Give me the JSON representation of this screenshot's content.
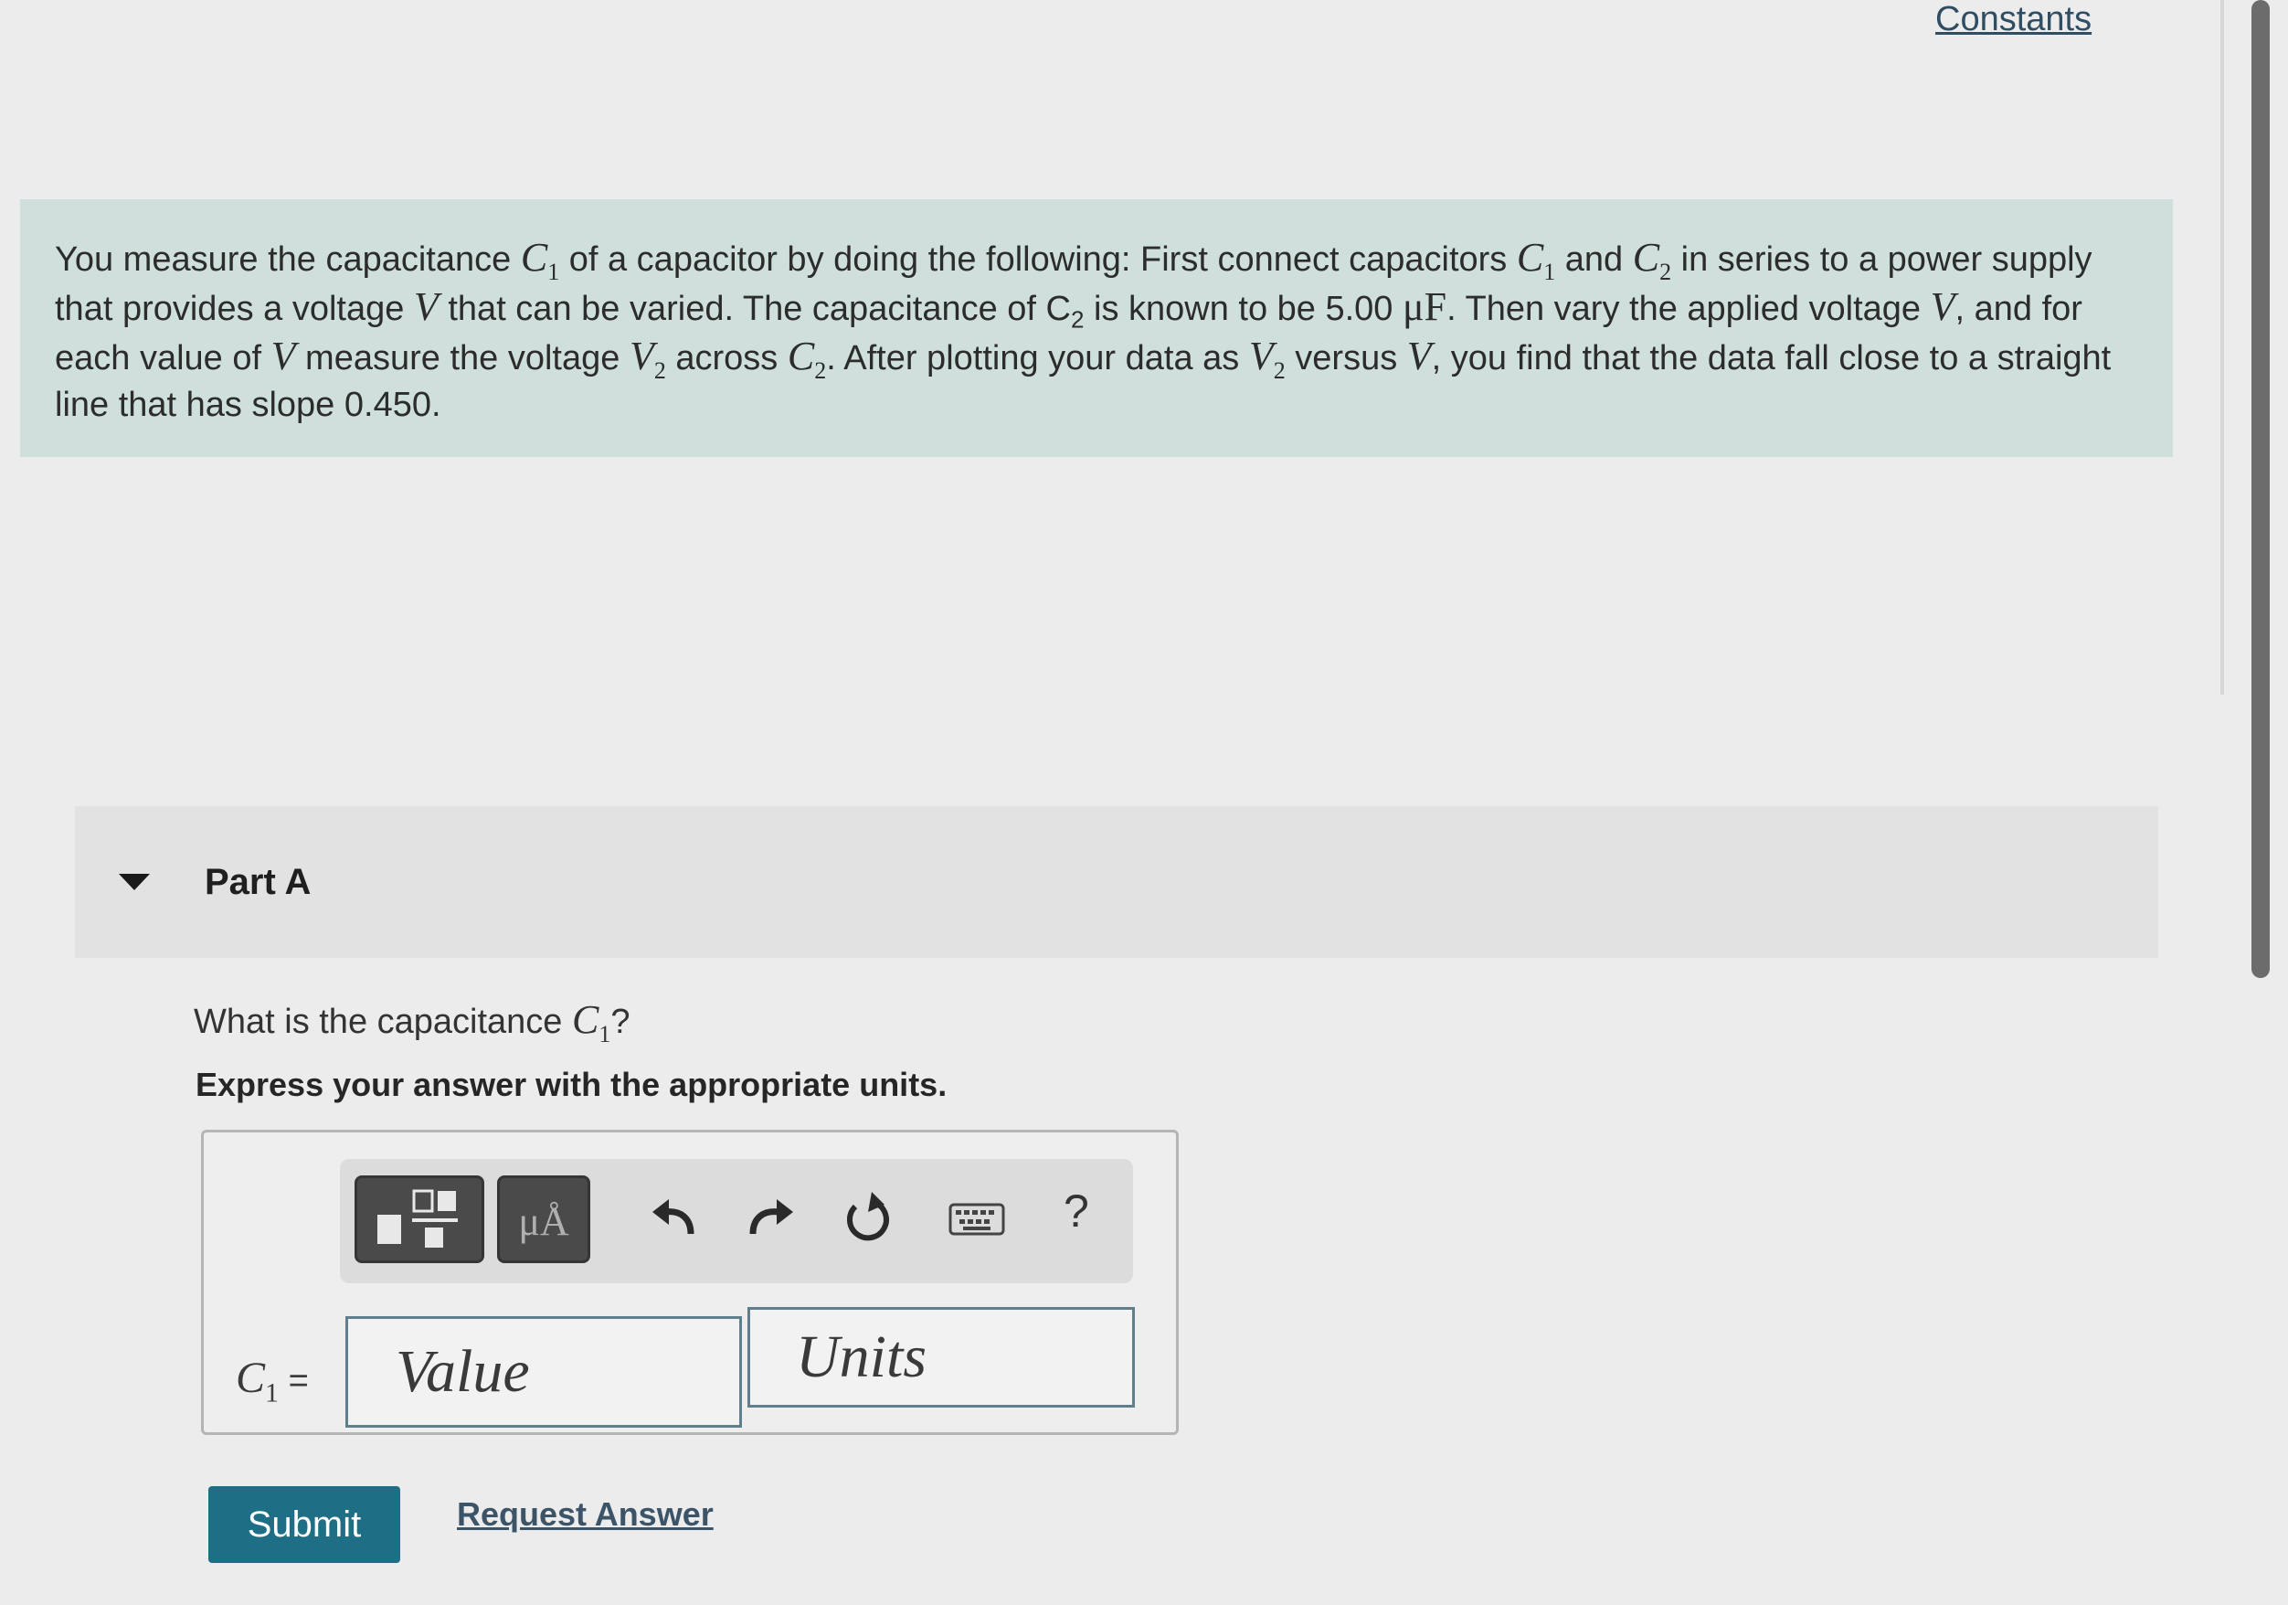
{
  "header": {
    "constants_label": "Constants"
  },
  "problem": {
    "t1": "You measure the capacitance ",
    "c1": "C",
    "c1_sub": "1",
    "t2": " of a capacitor by doing the following: First connect capacitors ",
    "t3": " and ",
    "c2": "C",
    "c2_sub": "2",
    "t4": " in series to a power supply that provides a voltage ",
    "v": "V",
    "t5": " that can be varied. The capacitance of C",
    "t5_sub": "2",
    "t6": " is known to be 5.00 ",
    "unit": "μF",
    "t7": ". Then vary the applied voltage ",
    "t8": ", and for each value of ",
    "t9": " measure the voltage ",
    "v2": "V",
    "v2_sub": "2",
    "t10": " across ",
    "t11": ". After plotting your data as ",
    "t12": " versus ",
    "t13": ", you find that the data fall close to a straight line that has slope 0.450."
  },
  "part": {
    "title": "Part A",
    "question_prefix": "What is the capacitance ",
    "question_var": "C",
    "question_sub": "1",
    "question_suffix": "?",
    "instruction": "Express your answer with the appropriate units."
  },
  "answer": {
    "label_var": "C",
    "label_sub": "1",
    "label_eq": " =",
    "value_placeholder": "Value",
    "units_placeholder": "Units"
  },
  "toolbar": {
    "units_button_label": "μÅ",
    "help_label": "?"
  },
  "actions": {
    "submit_label": "Submit",
    "request_answer_label": "Request Answer"
  }
}
